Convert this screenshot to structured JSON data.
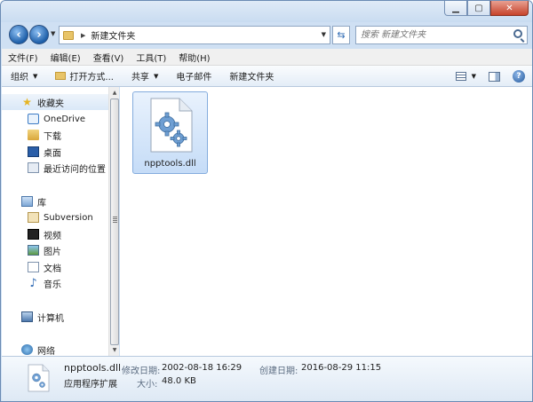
{
  "window": {
    "caption_buttons": {
      "minimize": "▁",
      "maximize": "▢",
      "close": "✕"
    }
  },
  "address_bar": {
    "path": "新建文件夹",
    "search_placeholder": "搜索 新建文件夹"
  },
  "menu": [
    "文件(F)",
    "编辑(E)",
    "查看(V)",
    "工具(T)",
    "帮助(H)"
  ],
  "toolbar": {
    "organize": "组织",
    "open_with": "打开方式...",
    "share": "共享",
    "email": "电子邮件",
    "new_folder": "新建文件夹"
  },
  "nav_pane": {
    "favorites": {
      "label": "收藏夹",
      "items": [
        "OneDrive",
        "下载",
        "桌面",
        "最近访问的位置"
      ]
    },
    "libraries": {
      "label": "库",
      "items": [
        "Subversion",
        "视频",
        "图片",
        "文档",
        "音乐"
      ]
    },
    "computer": "计算机",
    "network": "网络"
  },
  "files": [
    {
      "name": "npptools.dll",
      "icon": "dll-gear-icon",
      "selected": true
    }
  ],
  "details": {
    "file_name": "npptools.dll",
    "file_type": "应用程序扩展",
    "modified_label": "修改日期:",
    "modified_value": "2002-08-18 16:29",
    "created_label": "创建日期:",
    "created_value": "2016-08-29 11:15",
    "size_label": "大小:",
    "size_value": "48.0 KB"
  }
}
